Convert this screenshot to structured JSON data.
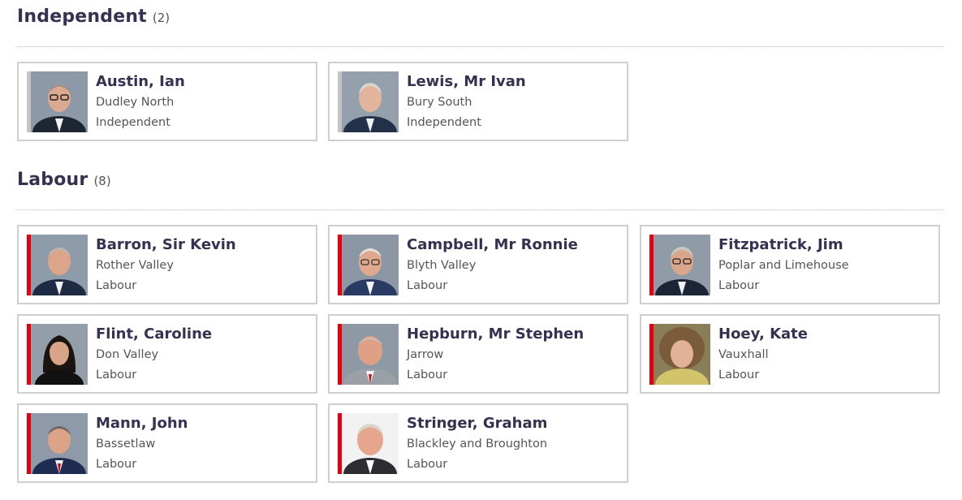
{
  "colors": {
    "independent": "#c4c4c4",
    "labour": "#e4000f",
    "heading": "#373151",
    "border": "#cfcfcf"
  },
  "sections": [
    {
      "title": "Independent",
      "count": "(2)",
      "members": [
        {
          "name": "Austin, Ian",
          "constituency": "Dudley North",
          "party": "Independent"
        },
        {
          "name": "Lewis, Mr Ivan",
          "constituency": "Bury South",
          "party": "Independent"
        }
      ]
    },
    {
      "title": "Labour",
      "count": "(8)",
      "members": [
        {
          "name": "Barron, Sir Kevin",
          "constituency": "Rother Valley",
          "party": "Labour"
        },
        {
          "name": "Campbell, Mr Ronnie",
          "constituency": "Blyth Valley",
          "party": "Labour"
        },
        {
          "name": "Fitzpatrick, Jim",
          "constituency": "Poplar and Limehouse",
          "party": "Labour"
        },
        {
          "name": "Flint, Caroline",
          "constituency": "Don Valley",
          "party": "Labour"
        },
        {
          "name": "Hepburn, Mr Stephen",
          "constituency": "Jarrow",
          "party": "Labour"
        },
        {
          "name": "Hoey, Kate",
          "constituency": "Vauxhall",
          "party": "Labour"
        },
        {
          "name": "Mann, John",
          "constituency": "Bassetlaw",
          "party": "Labour"
        },
        {
          "name": "Stringer, Graham",
          "constituency": "Blackley and Broughton",
          "party": "Labour"
        }
      ]
    }
  ]
}
